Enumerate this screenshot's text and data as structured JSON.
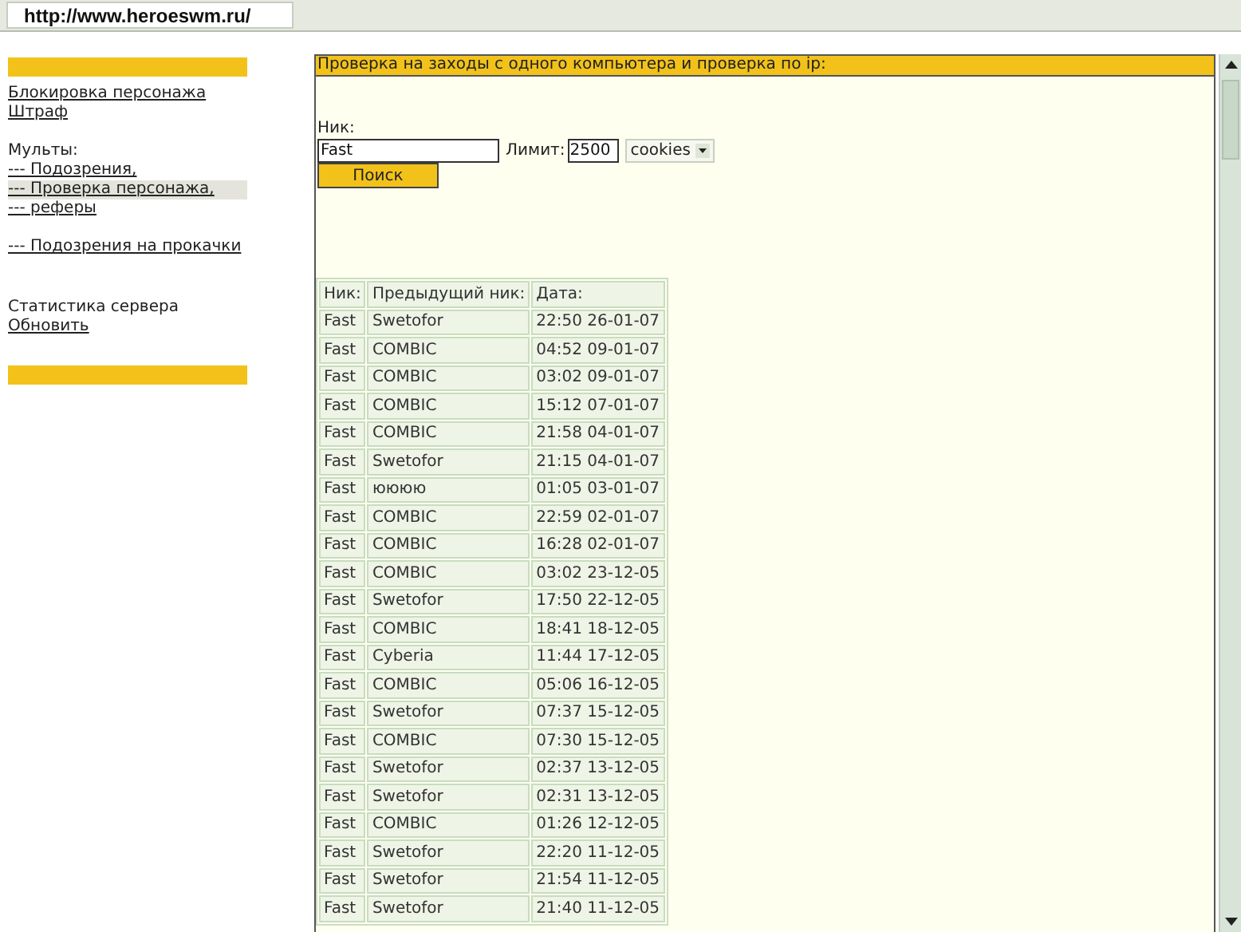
{
  "address_bar": {
    "url": "http://www.heroeswm.ru/"
  },
  "sidebar": {
    "groups": [
      {
        "items": [
          {
            "label": "Блокировка персонажа",
            "kind": "link",
            "selected": false
          },
          {
            "label": "Штраф",
            "kind": "link",
            "selected": false
          }
        ]
      },
      {
        "items": [
          {
            "label": "Мульты:",
            "kind": "text",
            "selected": false
          },
          {
            "label": "--- Подозрения,",
            "kind": "link",
            "selected": false
          },
          {
            "label": "--- Проверка персонажа,",
            "kind": "link",
            "selected": true
          },
          {
            "label": "--- реферы",
            "kind": "link",
            "selected": false
          }
        ]
      },
      {
        "items": [
          {
            "label": "--- Подозрения на прокачки",
            "kind": "link",
            "selected": false
          }
        ]
      },
      {
        "items": [
          {
            "label": "Статистика сервера",
            "kind": "text",
            "selected": false
          },
          {
            "label": "Обновить",
            "kind": "link",
            "selected": false
          }
        ]
      }
    ]
  },
  "panel": {
    "title": "Проверка на заходы с одного компьютера и проверка по ip:",
    "nick_label": "Ник:",
    "nick_value": "Fast",
    "limit_label": "Лимит:",
    "limit_value": "2500",
    "mode": "cookies",
    "search_button": "Поиск"
  },
  "table": {
    "columns": [
      "Ник:",
      "Предыдущий ник:",
      "Дата:"
    ],
    "rows": [
      [
        "Fast",
        "Swetofor",
        "22:50 26-01-07"
      ],
      [
        "Fast",
        "COMBIC",
        "04:52 09-01-07"
      ],
      [
        "Fast",
        "COMBIC",
        "03:02 09-01-07"
      ],
      [
        "Fast",
        "COMBIC",
        "15:12 07-01-07"
      ],
      [
        "Fast",
        "COMBIC",
        "21:58 04-01-07"
      ],
      [
        "Fast",
        "Swetofor",
        "21:15 04-01-07"
      ],
      [
        "Fast",
        "юююю",
        "01:05 03-01-07"
      ],
      [
        "Fast",
        "COMBIC",
        "22:59 02-01-07"
      ],
      [
        "Fast",
        "COMBIC",
        "16:28 02-01-07"
      ],
      [
        "Fast",
        "COMBIC",
        "03:02 23-12-05"
      ],
      [
        "Fast",
        "Swetofor",
        "17:50 22-12-05"
      ],
      [
        "Fast",
        "COMBIC",
        "18:41 18-12-05"
      ],
      [
        "Fast",
        "Cyberia",
        "11:44 17-12-05"
      ],
      [
        "Fast",
        "COMBIC",
        "05:06 16-12-05"
      ],
      [
        "Fast",
        "Swetofor",
        "07:37 15-12-05"
      ],
      [
        "Fast",
        "COMBIC",
        "07:30 15-12-05"
      ],
      [
        "Fast",
        "Swetofor",
        "02:37 13-12-05"
      ],
      [
        "Fast",
        "Swetofor",
        "02:31 13-12-05"
      ],
      [
        "Fast",
        "COMBIC",
        "01:26 12-12-05"
      ],
      [
        "Fast",
        "Swetofor",
        "22:20 11-12-05"
      ],
      [
        "Fast",
        "Swetofor",
        "21:54 11-12-05"
      ],
      [
        "Fast",
        "Swetofor",
        "21:40 11-12-05"
      ]
    ]
  }
}
